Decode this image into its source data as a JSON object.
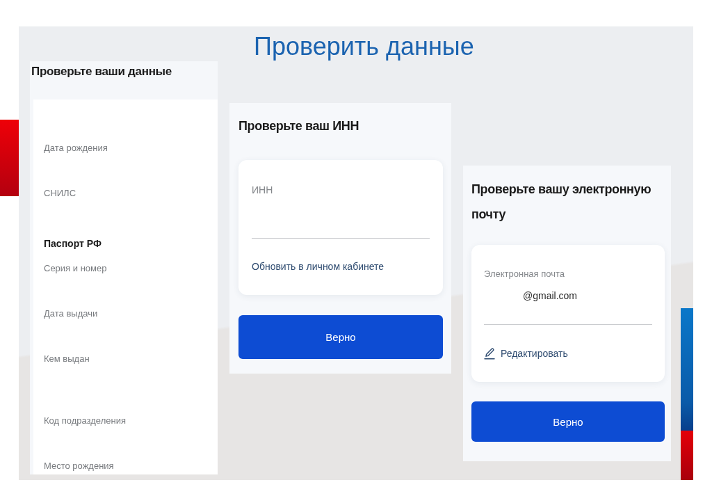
{
  "slide": {
    "title": "Проверить данные"
  },
  "personal_data": {
    "title": "Проверьте ваши данные",
    "items": [
      {
        "kind": "field",
        "label": "Дата рождения"
      },
      {
        "kind": "field",
        "label": "СНИЛС"
      },
      {
        "kind": "heading",
        "label": "Паспорт РФ"
      },
      {
        "kind": "field",
        "label": "Серия и номер"
      },
      {
        "kind": "field",
        "label": "Дата выдачи"
      },
      {
        "kind": "multiline",
        "label": "Кем выдан"
      },
      {
        "kind": "field",
        "label": "Код подразделения"
      },
      {
        "kind": "field",
        "label": "Место рождения"
      }
    ]
  },
  "inn_check": {
    "title": "Проверьте ваш ИНН",
    "field_label": "ИНН",
    "link": "Обновить в личном кабинете",
    "button": "Верно"
  },
  "email_check": {
    "title": "Проверьте вашу электронную почту",
    "field_label": "Электронная почта",
    "value": "@gmail.com",
    "edit_link": "Редактировать",
    "button": "Верно"
  }
}
